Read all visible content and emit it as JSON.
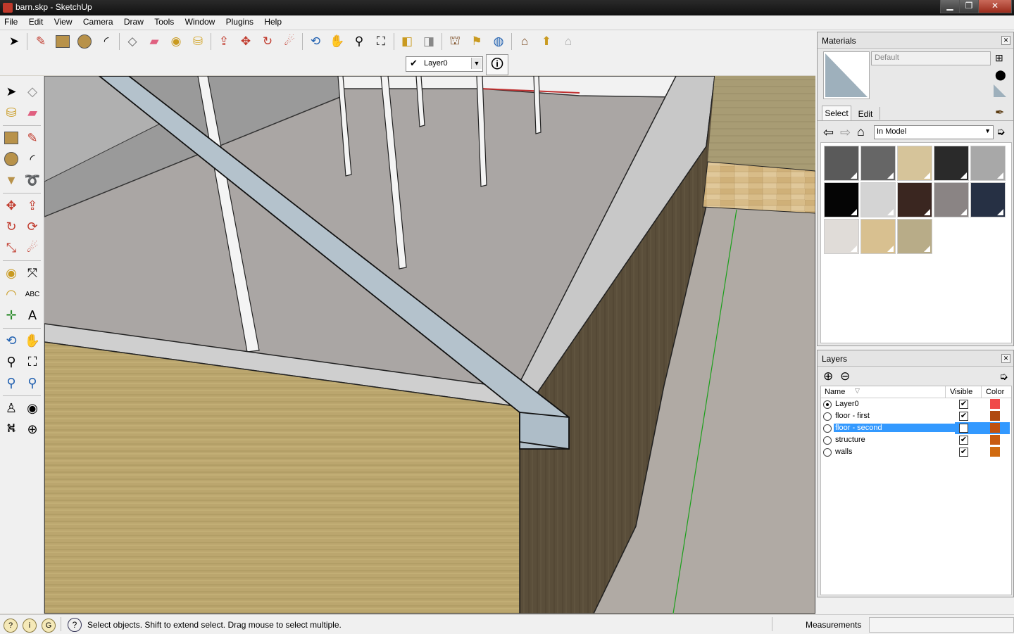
{
  "window": {
    "title": "barn.skp - SketchUp",
    "minimize": "▁",
    "maximize": "❐",
    "close": "✕"
  },
  "menu": [
    "File",
    "Edit",
    "View",
    "Camera",
    "Draw",
    "Tools",
    "Window",
    "Plugins",
    "Help"
  ],
  "toolbar": {
    "icons": [
      "select-icon",
      "pencil-icon",
      "rectangle-icon",
      "circle-icon",
      "arc-icon",
      "make-component-icon",
      "eraser-icon",
      "tape-measure-icon",
      "paint-bucket-icon",
      "push-pull-icon",
      "move-icon",
      "rotate-icon",
      "follow-me-icon",
      "orbit-icon",
      "pan-icon",
      "zoom-icon",
      "zoom-extents-icon",
      "previous-view-icon",
      "next-view-icon",
      "get-models-icon",
      "share-model-icon",
      "google-earth-icon",
      "warehouse-icon",
      "components-icon",
      "house-icon"
    ]
  },
  "layer_toolbar": {
    "current_layer": "Layer0"
  },
  "status": {
    "message": "Select objects. Shift to extend select. Drag mouse to select multiple.",
    "measurements_label": "Measurements"
  },
  "materials": {
    "title": "Materials",
    "name_field": "Default",
    "tabs": [
      "Select",
      "Edit"
    ],
    "collection": "In Model",
    "colors": {
      "default_preview": "#9eb0bc"
    },
    "swatches": [
      {
        "color": "#5a5a5a"
      },
      {
        "color": "#666666"
      },
      {
        "color": "#d6c49a"
      },
      {
        "color": "#2a2a2a"
      },
      {
        "color": "#a8a8a8"
      },
      {
        "color": "#050505"
      },
      {
        "color": "#d4d4d4"
      },
      {
        "color": "#3a2620"
      },
      {
        "color": "#8a8484"
      },
      {
        "color": "#263044"
      },
      {
        "color": "#e0dcd8"
      },
      {
        "color": "#d8c090"
      },
      {
        "color": "#b8ac88"
      }
    ]
  },
  "layers": {
    "title": "Layers",
    "columns": {
      "name": "Name",
      "visible": "Visible",
      "color": "Color"
    },
    "rows": [
      {
        "name": "Layer0",
        "active": true,
        "visible": true,
        "color": "#f04a4a",
        "selected": false
      },
      {
        "name": "floor - first",
        "active": false,
        "visible": true,
        "color": "#b04a10",
        "selected": false
      },
      {
        "name": "floor - second",
        "active": false,
        "visible": false,
        "color": "#c05010",
        "selected": true
      },
      {
        "name": "structure",
        "active": false,
        "visible": true,
        "color": "#c85a10",
        "selected": false
      },
      {
        "name": "walls",
        "active": false,
        "visible": true,
        "color": "#d06a10",
        "selected": false
      }
    ]
  }
}
